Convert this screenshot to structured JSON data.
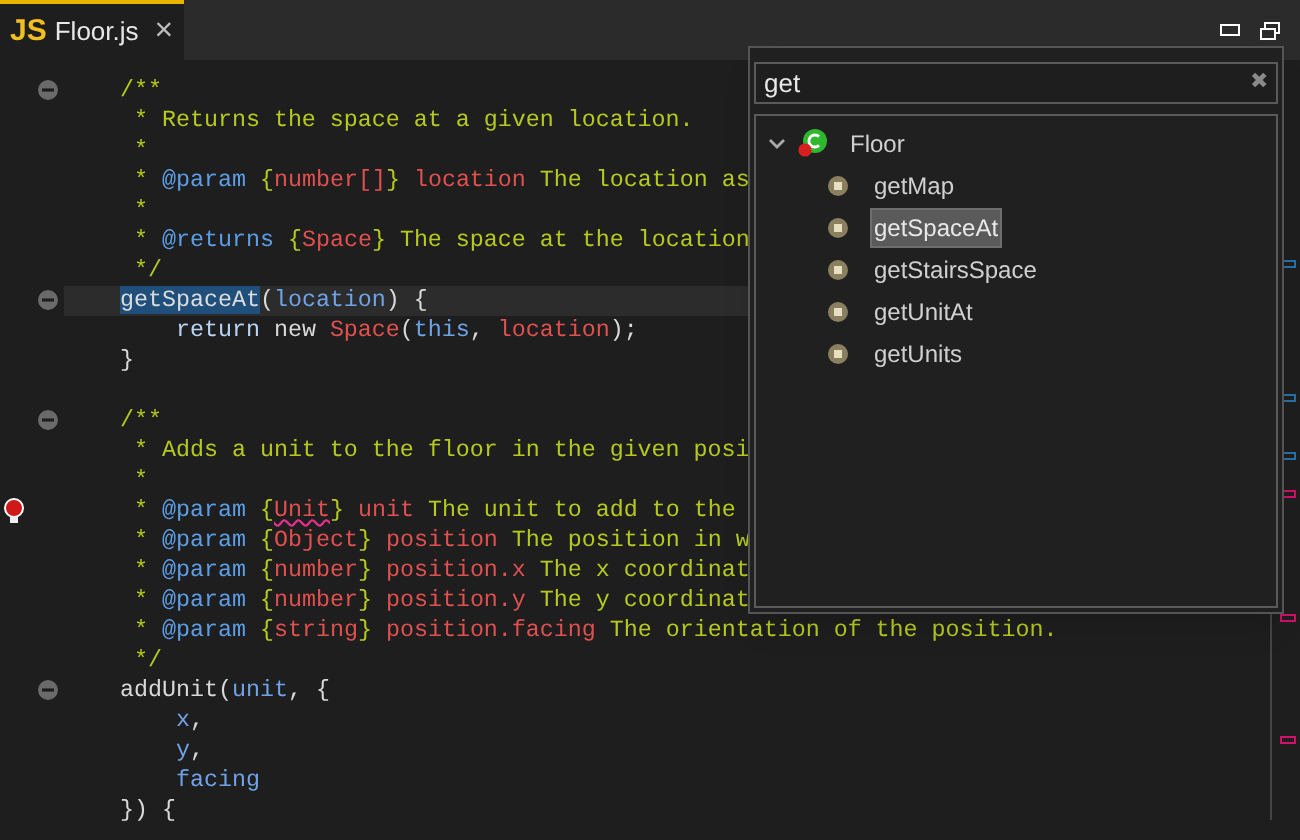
{
  "tab": {
    "icon_text": "JS",
    "label": "Floor.js",
    "close": "×",
    "selected": true
  },
  "editor": {
    "lines": [
      {
        "fold_marker": true,
        "highlighted": false,
        "tokens": [
          {
            "text": "/**",
            "kind": "comment"
          }
        ]
      },
      {
        "highlighted": false,
        "tokens": [
          {
            "text": " * Returns the space at a given location.",
            "kind": "comment"
          }
        ]
      },
      {
        "highlighted": false,
        "tokens": [
          {
            "text": " *",
            "kind": "comment"
          }
        ]
      },
      {
        "highlighted": false,
        "tokens": [
          {
            "text": " * ",
            "kind": "comment"
          },
          {
            "text": "@param",
            "kind": "tag"
          },
          {
            "text": " {",
            "kind": "comment"
          },
          {
            "text": "number[]",
            "kind": "type"
          },
          {
            "text": "} ",
            "kind": "comment"
          },
          {
            "text": "location",
            "kind": "type"
          },
          {
            "text": " The location as",
            "kind": "comment"
          }
        ]
      },
      {
        "highlighted": false,
        "tokens": [
          {
            "text": " *",
            "kind": "comment"
          }
        ]
      },
      {
        "highlighted": false,
        "tokens": [
          {
            "text": " * ",
            "kind": "comment"
          },
          {
            "text": "@returns",
            "kind": "tag"
          },
          {
            "text": " {",
            "kind": "comment"
          },
          {
            "text": "Space",
            "kind": "type"
          },
          {
            "text": "} The space at the location",
            "kind": "comment"
          }
        ]
      },
      {
        "highlighted": false,
        "tokens": [
          {
            "text": " */",
            "kind": "comment"
          }
        ]
      },
      {
        "fold_marker": true,
        "highlighted": true,
        "tokens": [
          {
            "text": "getSpaceAt",
            "kind": "selection"
          },
          {
            "text": "(",
            "kind": "plain"
          },
          {
            "text": "location",
            "kind": "param"
          },
          {
            "text": ") {",
            "kind": "plain"
          }
        ]
      },
      {
        "highlighted": false,
        "tokens": [
          {
            "text": "    return",
            "kind": "keyword"
          },
          {
            "text": " new ",
            "kind": "plain"
          },
          {
            "text": "Space",
            "kind": "type"
          },
          {
            "text": "(",
            "kind": "plain"
          },
          {
            "text": "this",
            "kind": "param"
          },
          {
            "text": ", ",
            "kind": "plain"
          },
          {
            "text": "location",
            "kind": "type"
          },
          {
            "text": ");",
            "kind": "plain"
          }
        ]
      },
      {
        "highlighted": false,
        "tokens": [
          {
            "text": "}",
            "kind": "plain"
          }
        ]
      },
      {
        "highlighted": false
      },
      {
        "fold_marker": true,
        "highlighted": false,
        "tokens": [
          {
            "text": "/**",
            "kind": "comment"
          }
        ]
      },
      {
        "highlighted": false,
        "tokens": [
          {
            "text": " * Adds a unit to the floor in the given posi",
            "kind": "comment"
          }
        ]
      },
      {
        "highlighted": false,
        "tokens": [
          {
            "text": " *",
            "kind": "comment"
          }
        ]
      },
      {
        "lightbulb": true,
        "highlighted": false,
        "tokens": [
          {
            "text": " * ",
            "kind": "comment"
          },
          {
            "text": "@param",
            "kind": "tag"
          },
          {
            "text": " {",
            "kind": "comment"
          },
          {
            "text": "Unit",
            "kind": "misspelled"
          },
          {
            "text": "} ",
            "kind": "comment"
          },
          {
            "text": "unit",
            "kind": "type"
          },
          {
            "text": " The unit to add to the",
            "kind": "comment"
          }
        ]
      },
      {
        "highlighted": false,
        "tokens": [
          {
            "text": " * ",
            "kind": "comment"
          },
          {
            "text": "@param",
            "kind": "tag"
          },
          {
            "text": " {",
            "kind": "comment"
          },
          {
            "text": "Object",
            "kind": "type"
          },
          {
            "text": "} ",
            "kind": "comment"
          },
          {
            "text": "position",
            "kind": "type"
          },
          {
            "text": " The position in w",
            "kind": "comment"
          }
        ]
      },
      {
        "highlighted": false,
        "tokens": [
          {
            "text": " * ",
            "kind": "comment"
          },
          {
            "text": "@param",
            "kind": "tag"
          },
          {
            "text": " {",
            "kind": "comment"
          },
          {
            "text": "number",
            "kind": "type"
          },
          {
            "text": "} ",
            "kind": "comment"
          },
          {
            "text": "position.x",
            "kind": "type"
          },
          {
            "text": " The x coordinat",
            "kind": "comment"
          }
        ]
      },
      {
        "highlighted": false,
        "tokens": [
          {
            "text": " * ",
            "kind": "comment"
          },
          {
            "text": "@param",
            "kind": "tag"
          },
          {
            "text": " {",
            "kind": "comment"
          },
          {
            "text": "number",
            "kind": "type"
          },
          {
            "text": "} ",
            "kind": "comment"
          },
          {
            "text": "position.y",
            "kind": "type"
          },
          {
            "text": " The y coordinat",
            "kind": "comment"
          }
        ]
      },
      {
        "highlighted": false,
        "tokens": [
          {
            "text": " * ",
            "kind": "comment"
          },
          {
            "text": "@param",
            "kind": "tag"
          },
          {
            "text": " {",
            "kind": "comment"
          },
          {
            "text": "string",
            "kind": "type"
          },
          {
            "text": "} ",
            "kind": "comment"
          },
          {
            "text": "position.facing",
            "kind": "type"
          },
          {
            "text": " The orientation of the position.",
            "kind": "comment"
          }
        ]
      },
      {
        "highlighted": false,
        "tokens": [
          {
            "text": " */",
            "kind": "comment"
          }
        ]
      },
      {
        "fold_marker": true,
        "highlighted": false,
        "tokens": [
          {
            "text": "addUnit",
            "kind": "plain"
          },
          {
            "text": "(",
            "kind": "plain"
          },
          {
            "text": "unit",
            "kind": "param"
          },
          {
            "text": ", {",
            "kind": "plain"
          }
        ]
      },
      {
        "highlighted": false,
        "tokens": [
          {
            "text": "    x",
            "kind": "param"
          },
          {
            "text": ",",
            "kind": "plain"
          }
        ]
      },
      {
        "highlighted": false,
        "tokens": [
          {
            "text": "    y",
            "kind": "param"
          },
          {
            "text": ",",
            "kind": "plain"
          }
        ]
      },
      {
        "highlighted": false,
        "tokens": [
          {
            "text": "    facing",
            "kind": "param"
          }
        ]
      },
      {
        "highlighted": false,
        "tokens": [
          {
            "text": "}) {",
            "kind": "plain"
          }
        ]
      }
    ]
  },
  "outline_popup": {
    "search": {
      "value": "get",
      "clear": "✖"
    },
    "tree": [
      {
        "label": "Floor",
        "kind": "class",
        "expanded": true,
        "selected": false,
        "children": [
          {
            "label": "getMap",
            "kind": "method",
            "selected": false
          },
          {
            "label": "getSpaceAt",
            "kind": "method",
            "selected": true
          },
          {
            "label": "getStairsSpace",
            "kind": "method",
            "selected": false
          },
          {
            "label": "getUnitAt",
            "kind": "method",
            "selected": false
          },
          {
            "label": "getUnits",
            "kind": "method",
            "selected": false
          }
        ]
      }
    ]
  }
}
